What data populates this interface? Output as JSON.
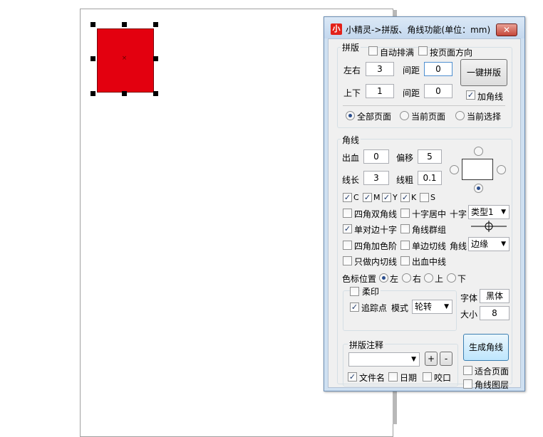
{
  "dialog": {
    "title": "小精灵->拼版、角线功能(单位：mm)",
    "icon_text": "小",
    "close_symbol": "✕"
  },
  "imposition": {
    "group_title": "拼版",
    "auto_fill": "自动排满",
    "page_direction": "按页面方向",
    "lr_label": "左右",
    "lr_value": "3",
    "lr_gap_label": "间距",
    "lr_gap_value": "0",
    "ud_label": "上下",
    "ud_value": "1",
    "ud_gap_label": "间距",
    "ud_gap_value": "0",
    "one_click_btn": "一键拼版",
    "add_cropmarks": "加角线",
    "all_pages": "全部页面",
    "current_page": "当前页面",
    "current_selection": "当前选择"
  },
  "cropmarks": {
    "group_title": "角线",
    "bleed_label": "出血",
    "bleed_value": "0",
    "offset_label": "偏移",
    "offset_value": "5",
    "length_label": "线长",
    "length_value": "3",
    "thickness_label": "线粗",
    "thickness_value": "0.1",
    "colors": [
      "C",
      "M",
      "Y",
      "K",
      "S"
    ],
    "double_corner": "四角双角线",
    "cross_center": "十字居中",
    "cross_label": "十字",
    "cross_type": "类型1",
    "single_cross": "单对边十字",
    "group_cropmarks": "角线群组",
    "corner_color_steps": "四角加色阶",
    "single_edge_cut": "单边切线",
    "cropmark_label": "角线",
    "cropmark_mode": "边缘",
    "inner_cut_only": "只做内切线",
    "bleed_centerline": "出血中线",
    "color_bar_label": "色标位置",
    "pos_left": "左",
    "pos_right": "右",
    "pos_top": "上",
    "pos_bottom": "下",
    "soft_print": "柔印",
    "tracking_point": "追踪点",
    "mode_label": "模式",
    "mode_value": "轮转",
    "font_label": "字体",
    "font_value": "黑体",
    "size_label": "大小",
    "size_value": "8",
    "notes_title": "拼版注释",
    "plus": "+",
    "minus": "-",
    "file_name": "文件名",
    "date": "日期",
    "bite": "咬口",
    "generate_btn": "生成角线",
    "fit_page": "适合页面",
    "cropmark_layer": "角线图层"
  },
  "accent_color": "#e3000f"
}
